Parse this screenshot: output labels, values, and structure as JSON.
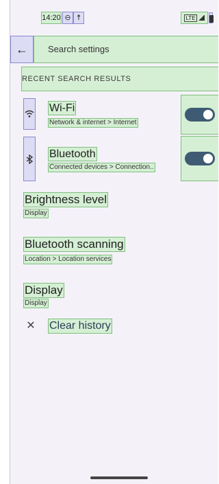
{
  "status_bar": {
    "time": "14:20",
    "icons": [
      "sync-icon",
      "accessibility-icon"
    ],
    "network": "LTE"
  },
  "search": {
    "placeholder": "Search settings"
  },
  "section_header": "RECENT SEARCH RESULTS",
  "recent_results": [
    {
      "title": "Wi-Fi",
      "subtitle": "Network & internet > Internet",
      "icon": "wifi-icon",
      "toggle_on": true
    },
    {
      "title": "Bluetooth",
      "subtitle": "Connected devices > Connection..",
      "icon": "bluetooth-icon",
      "toggle_on": true
    },
    {
      "title": "Brightness level",
      "subtitle": "Display"
    },
    {
      "title": "Bluetooth scanning",
      "subtitle": "Location > Location services"
    },
    {
      "title": "Display",
      "subtitle": "Display"
    }
  ],
  "clear_history_label": "Clear history",
  "colors": {
    "toggle_track": "#3f5a73",
    "background": "#f4f2f8",
    "highlight_green": "#d5efd4",
    "highlight_blue": "#dcdcf4"
  }
}
